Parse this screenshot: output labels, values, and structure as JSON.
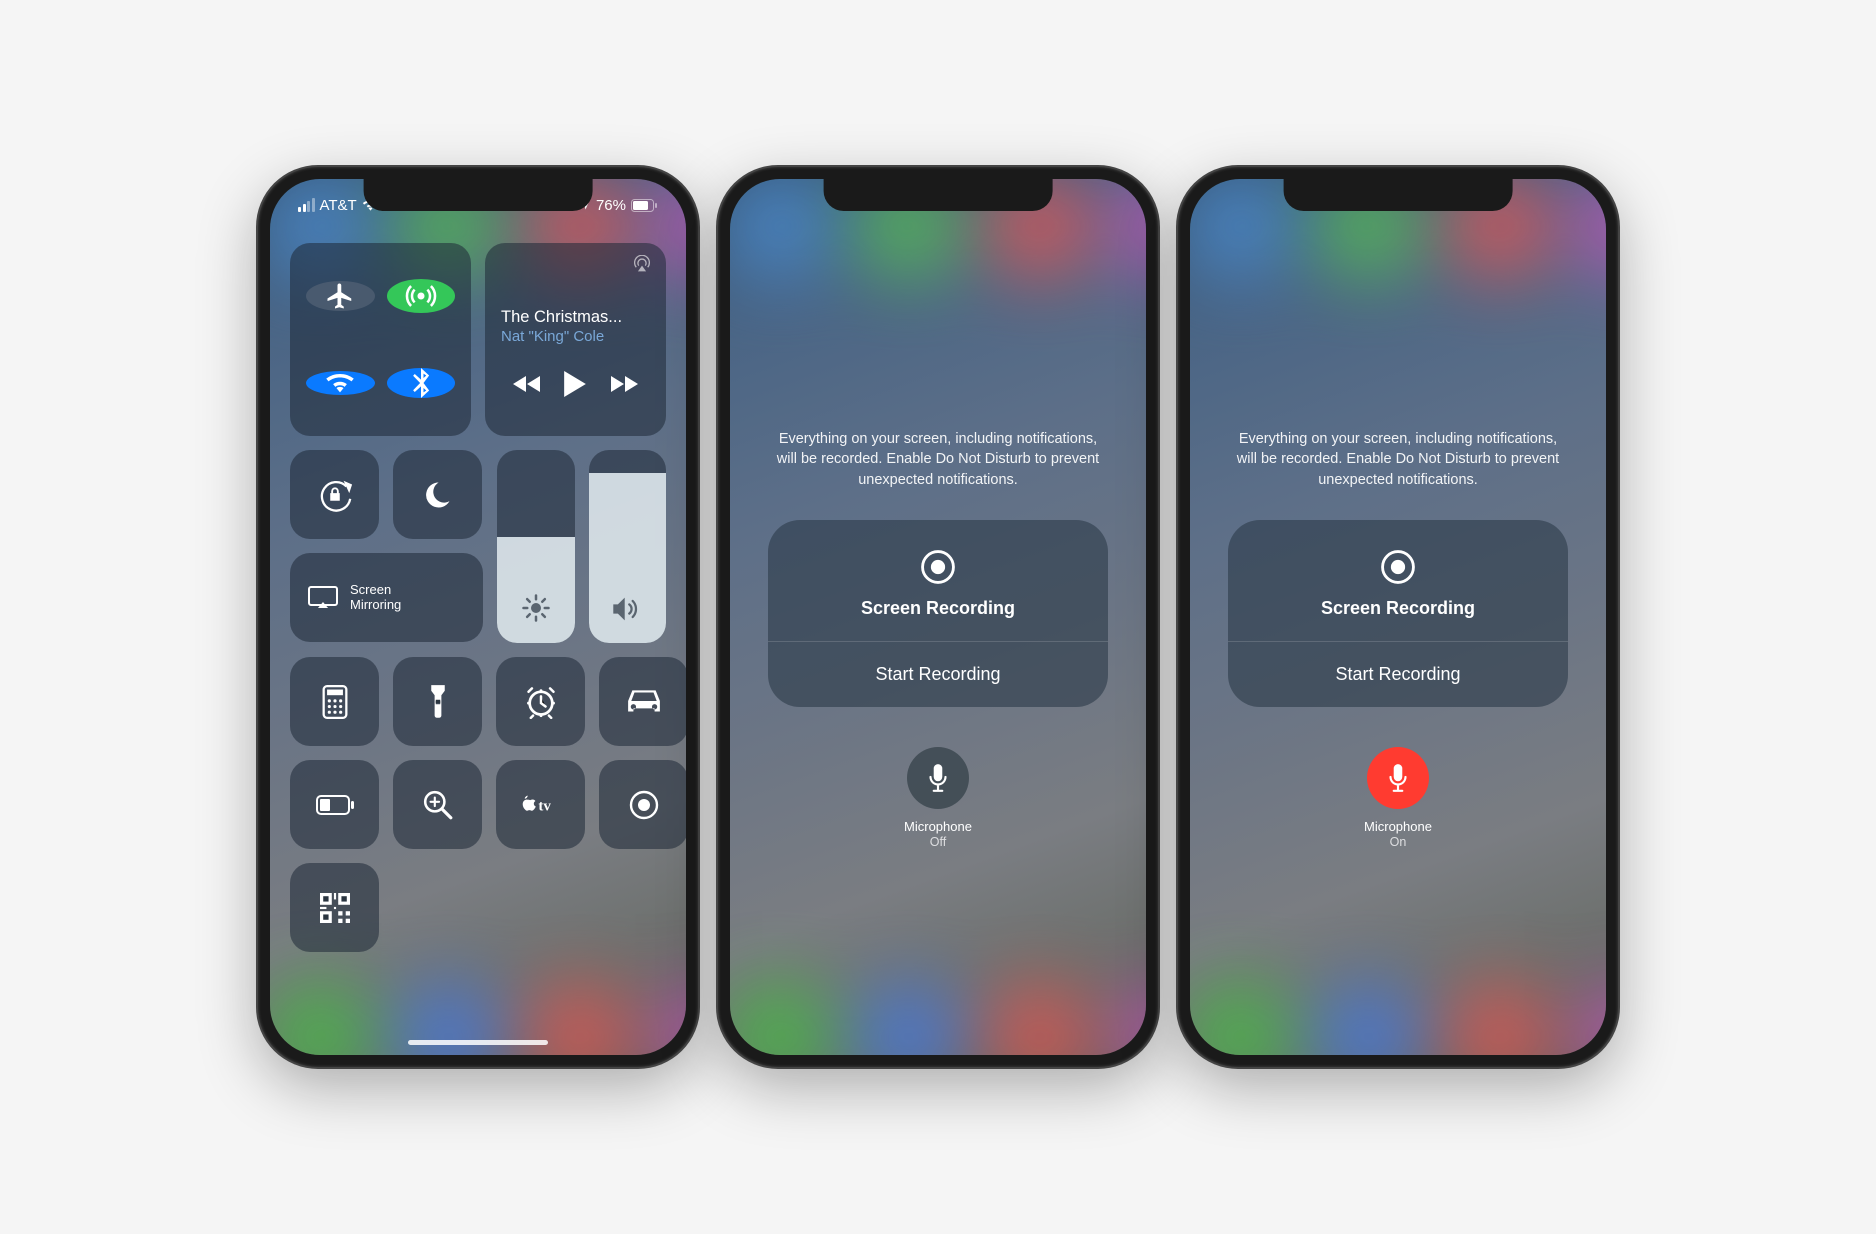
{
  "statusBar": {
    "carrier": "AT&T",
    "battery": "76%"
  },
  "media": {
    "title": "The Christmas...",
    "artist": "Nat \"King\" Cole"
  },
  "screenMirroring": {
    "line1": "Screen",
    "line2": "Mirroring"
  },
  "controls": {
    "airplane": "airplane-mode",
    "cellular": "cellular-data",
    "wifi": "wifi",
    "bluetooth": "bluetooth",
    "orientationLock": "orientation-lock",
    "doNotDisturb": "do-not-disturb",
    "brightness": "brightness",
    "volume": "volume"
  },
  "shortcuts": [
    "calculator",
    "flashlight",
    "alarm",
    "driving",
    "low-power",
    "magnifier",
    "apple-tv",
    "screen-record",
    "qr-code"
  ],
  "recordingDetail": {
    "hint": "Everything on your screen, including notifications, will be recorded. Enable Do Not Disturb to prevent unexpected notifications.",
    "title": "Screen Recording",
    "start": "Start Recording",
    "micLabel": "Microphone",
    "micOff": "Off",
    "micOn": "On"
  }
}
